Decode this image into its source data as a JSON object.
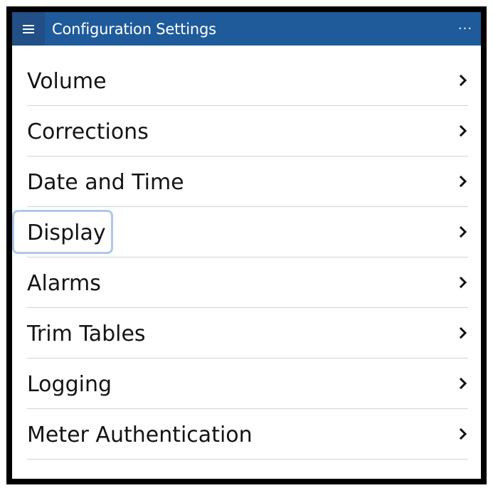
{
  "app_bar": {
    "menu_icon": "hamburger-icon",
    "title": "Configuration Settings",
    "more_label": "···",
    "background": "#1f5b9b"
  },
  "settings": {
    "items": [
      {
        "label": "Volume"
      },
      {
        "label": "Corrections"
      },
      {
        "label": "Date and Time"
      },
      {
        "label": "Display",
        "focused": true
      },
      {
        "label": "Alarms"
      },
      {
        "label": "Trim Tables"
      },
      {
        "label": "Logging"
      },
      {
        "label": "Meter Authentication"
      }
    ],
    "chevron_icon": "chevron-right-icon",
    "focus_color": "#aec8e9"
  }
}
